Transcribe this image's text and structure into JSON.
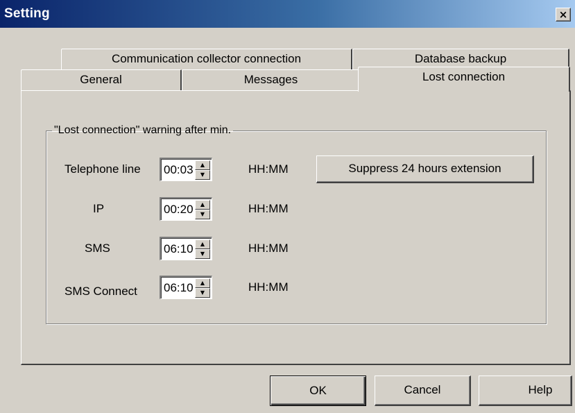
{
  "window": {
    "title": "Setting",
    "close_glyph": "×"
  },
  "tabs": {
    "row_back": [
      {
        "label": "Communication collector connection"
      },
      {
        "label": "Database backup"
      }
    ],
    "row_front": [
      {
        "label": "General"
      },
      {
        "label": "Messages"
      },
      {
        "label": "Lost connection",
        "active": true
      }
    ]
  },
  "group": {
    "legend": "\"Lost connection\" warning after min.",
    "rows": [
      {
        "label": "Telephone line",
        "value": "00:03",
        "unit": "HH:MM"
      },
      {
        "label": "IP",
        "value": "00:20",
        "unit": "HH:MM"
      },
      {
        "label": "SMS",
        "value": "06:10",
        "unit": "HH:MM"
      },
      {
        "label": "SMS Connect",
        "value": "06:10",
        "unit": "HH:MM"
      }
    ],
    "suppress_button": "Suppress 24 hours extension"
  },
  "spinner": {
    "up_glyph": "▲",
    "down_glyph": "▼"
  },
  "footer": {
    "ok": "OK",
    "cancel": "Cancel",
    "help": "Help"
  }
}
